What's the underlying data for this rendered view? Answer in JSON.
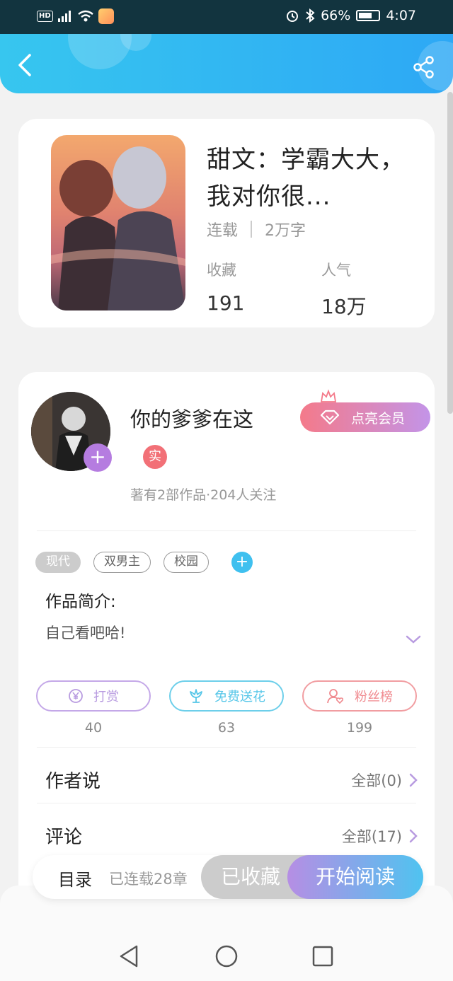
{
  "status_bar": {
    "hd": "HD",
    "signal": "⁴ᴳ",
    "battery": "66%",
    "time": "4:07"
  },
  "book": {
    "title": "甜文：学霸大大，我对你很...",
    "status": "连载",
    "word_count": "2万字",
    "favorites_label": "收藏",
    "favorites_value": "191",
    "popularity_label": "人气",
    "popularity_value": "18万"
  },
  "author": {
    "name": "你的爹爹在这",
    "follow_icon": "+",
    "vip_label": "点亮会员",
    "real_badge": "实",
    "stats": "著有2部作品·204人关注"
  },
  "tags": [
    "现代",
    "双男主",
    "校园"
  ],
  "tag_add": "+",
  "intro": {
    "title": "作品简介:",
    "text": "自己看吧哈!"
  },
  "actions": [
    {
      "label": "打赏",
      "count": "40",
      "color": "#b89be0"
    },
    {
      "label": "免费送花",
      "count": "63",
      "color": "#55c6e8"
    },
    {
      "label": "粉丝榜",
      "count": "199",
      "color": "#f08a8f"
    }
  ],
  "author_says": {
    "title": "作者说",
    "link": "全部(0)"
  },
  "comments": {
    "title": "评论",
    "link": "全部(17)"
  },
  "bottom_bar": {
    "toc": "目录",
    "chapters": "已连载28章",
    "collected": "已收藏",
    "start_reading": "开始阅读"
  },
  "colors": {
    "header_start": "#37c6ef",
    "header_end": "#2da8f5",
    "accent_purple": "#b57ce0"
  }
}
